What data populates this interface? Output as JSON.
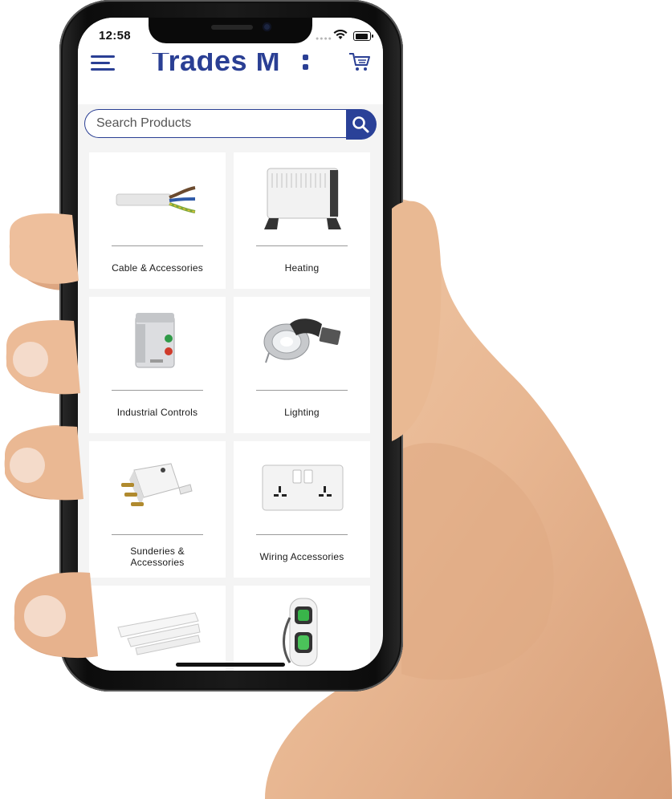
{
  "status_bar": {
    "time": "12:58"
  },
  "header": {
    "logo_text": "Trades M",
    "logo_mark": "menu-icon"
  },
  "search": {
    "placeholder": "Search Products"
  },
  "categories": [
    {
      "label": "Cable & Accessories",
      "icon": "cable-icon"
    },
    {
      "label": "Heating",
      "icon": "heater-icon"
    },
    {
      "label": "Industrial Controls",
      "icon": "control-box-icon"
    },
    {
      "label": "Lighting",
      "icon": "downlight-icon"
    },
    {
      "label": "Sunderies & Accessories",
      "icon": "plug-icon"
    },
    {
      "label": "Wiring Accessories",
      "icon": "socket-icon"
    },
    {
      "label": "",
      "icon": "trunking-icon"
    },
    {
      "label": "",
      "icon": "ev-charger-icon"
    }
  ],
  "colors": {
    "brand": "#2a3f94",
    "search_button": "#2a4198",
    "card_bg": "#ffffff",
    "screen_bg": "#f4f4f4"
  }
}
